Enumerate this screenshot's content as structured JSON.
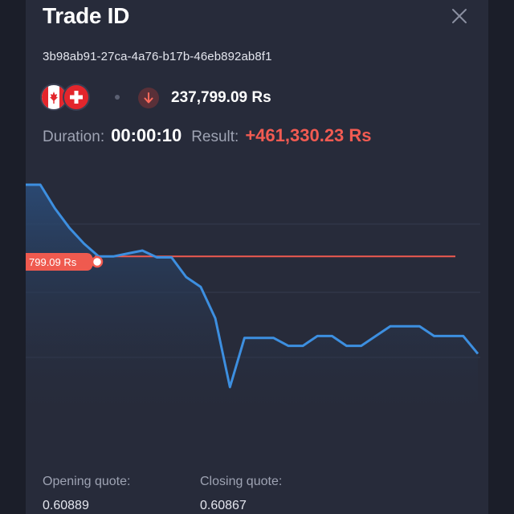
{
  "header": {
    "title": "Trade ID",
    "close_icon": "close-icon"
  },
  "trade": {
    "id": "3b98ab91-27ca-4a76-b17b-46eb892ab8f1",
    "pair_flags": [
      "canada-flag",
      "switzerland-flag"
    ],
    "direction_icon": "arrow-down-icon",
    "amount": "237,799.09 Rs"
  },
  "stats": {
    "duration_label": "Duration:",
    "duration_value": "00:00:10",
    "result_label": "Result:",
    "result_value": "+461,330.23 Rs"
  },
  "chart": {
    "entry_label": "799.09 Rs"
  },
  "chart_data": {
    "type": "area",
    "x": [
      0,
      1,
      2,
      3,
      4,
      5,
      6,
      7,
      8,
      9,
      10,
      11,
      12,
      13,
      14,
      15,
      16,
      17,
      18,
      19,
      20,
      21,
      22,
      23,
      24,
      25,
      26,
      27,
      28,
      29,
      30,
      31
    ],
    "series": [
      {
        "values": [
          1.0,
          1.0,
          0.76,
          0.56,
          0.4,
          0.27,
          0.27,
          0.3,
          0.33,
          0.26,
          0.26,
          0.06,
          -0.04,
          -0.36,
          -1.06,
          -0.56,
          -0.56,
          -0.56,
          -0.64,
          -0.64,
          -0.54,
          -0.54,
          -0.64,
          -0.64,
          -0.54,
          -0.44,
          -0.44,
          -0.44,
          -0.54,
          -0.54,
          -0.54,
          -0.72
        ]
      }
    ],
    "entry_level": 0.27,
    "colors": {
      "line": "#3d8fe0",
      "fill_top": "#2a4a75",
      "entry_line": "#ef5a4f"
    }
  },
  "quotes": {
    "opening_label": "Opening quote:",
    "opening_value": "0.60889",
    "closing_label": "Closing quote:",
    "closing_value": "0.60867"
  },
  "colors": {
    "panel_bg": "#272b3a",
    "page_bg": "#1b1e29",
    "negative": "#f25b52"
  }
}
